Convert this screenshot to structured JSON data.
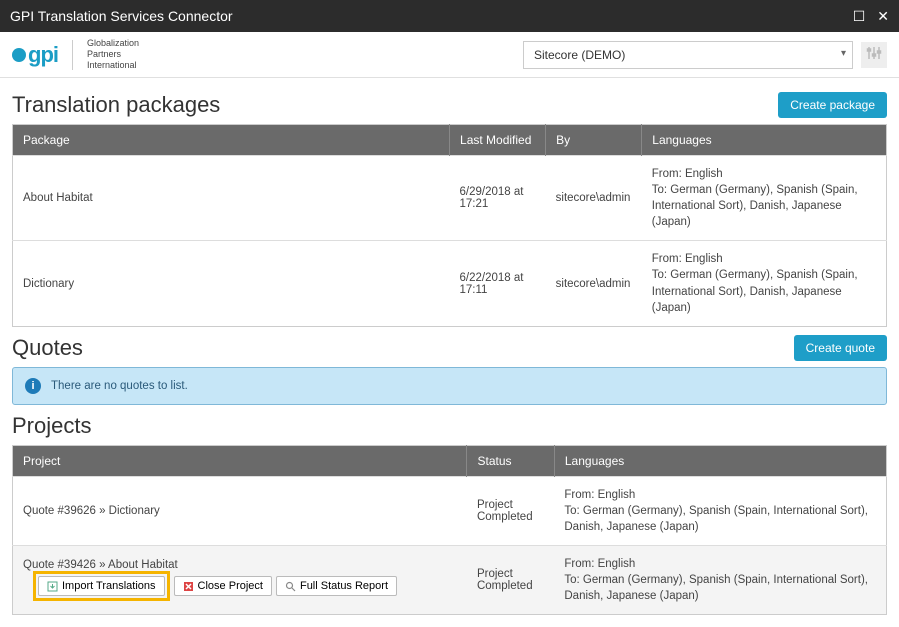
{
  "titlebar": {
    "title": "GPI Translation Services Connector"
  },
  "logo": {
    "text": "gpi",
    "tagline1": "Globalization",
    "tagline2": "Partners",
    "tagline3": "International"
  },
  "site_select": {
    "value": "Sitecore (DEMO)"
  },
  "packages": {
    "heading": "Translation packages",
    "create_btn": "Create package",
    "cols": [
      "Package",
      "Last Modified",
      "By",
      "Languages"
    ],
    "rows": [
      {
        "name": "About Habitat",
        "modified": "6/29/2018 at 17:21",
        "by": "sitecore\\admin",
        "from": "From: English",
        "to": "To: German (Germany), Spanish (Spain, International Sort), Danish, Japanese (Japan)"
      },
      {
        "name": "Dictionary",
        "modified": "6/22/2018 at 17:11",
        "by": "sitecore\\admin",
        "from": "From: English",
        "to": "To: German (Germany), Spanish (Spain, International Sort), Danish, Japanese (Japan)"
      }
    ]
  },
  "quotes": {
    "heading": "Quotes",
    "create_btn": "Create quote",
    "empty_msg": "There are no quotes to list."
  },
  "projects": {
    "heading": "Projects",
    "cols": [
      "Project",
      "Status",
      "Languages"
    ],
    "rows": [
      {
        "name": "Quote #39626 » Dictionary",
        "status": "Project Completed",
        "from": "From: English",
        "to": "To: German (Germany), Spanish (Spain, International Sort), Danish, Japanese (Japan)",
        "actions": false
      },
      {
        "name": "Quote #39426 » About Habitat",
        "status": "Project Completed",
        "from": "From: English",
        "to": "To: German (Germany), Spanish (Spain, International Sort), Danish, Japanese (Japan)",
        "actions": true
      }
    ],
    "action_labels": {
      "import": "Import Translations",
      "close": "Close Project",
      "report": "Full Status Report"
    }
  }
}
